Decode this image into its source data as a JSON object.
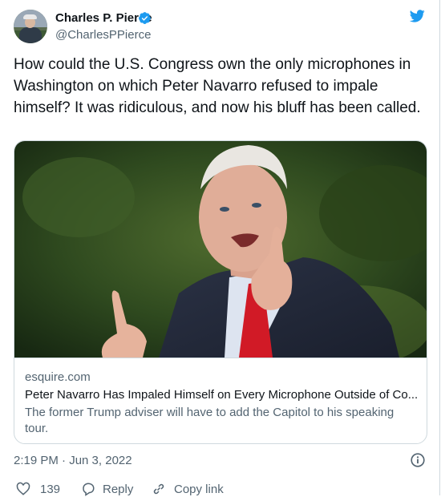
{
  "author": {
    "name": "Charles P. Pierce",
    "handle": "@CharlesPPierce"
  },
  "tweet": {
    "text": "How could the U.S. Congress own the only microphones in Washington on which Peter Navarro refused to impale himself? It was ridiculous, and now his bluff has been called.",
    "timestamp": "2:19 PM · Jun 3, 2022"
  },
  "card": {
    "domain": "esquire.com",
    "title": "Peter Navarro Has Impaled Himself on Every Microphone Outside of Co...",
    "description": "The former Trump adviser will have to add the Capitol to his speaking tour."
  },
  "actions": {
    "like_count": "139",
    "reply_label": "Reply",
    "copy_link_label": "Copy link"
  },
  "colors": {
    "text_primary": "#0f1419",
    "text_secondary": "#536471",
    "twitter_blue": "#1d9bf0",
    "border": "#cfd9de"
  },
  "icons": [
    "verified-badge-icon",
    "twitter-bird-icon",
    "info-icon",
    "heart-icon",
    "reply-icon",
    "copy-link-icon"
  ]
}
